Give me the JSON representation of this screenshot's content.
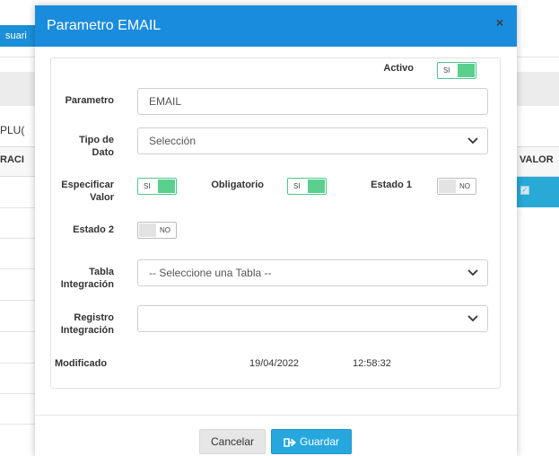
{
  "background": {
    "tab_label": "suari",
    "section_label": "PLU(",
    "table_header_left": "RACI",
    "table_header_right": "VALOR"
  },
  "modal": {
    "title": "Parametro EMAIL",
    "close_icon": "close-icon",
    "activo": {
      "label": "Activo",
      "state": "SI"
    },
    "parametro": {
      "label": "Parametro",
      "value": "EMAIL"
    },
    "tipo_dato": {
      "label": "Tipo de Dato",
      "value": "Selección"
    },
    "especificar_valor": {
      "label": "Especificar Valor",
      "state": "SI"
    },
    "obligatorio": {
      "label": "Obligatorio",
      "state": "SI"
    },
    "estado1": {
      "label": "Estado 1",
      "state": "NO"
    },
    "estado2": {
      "label": "Estado 2",
      "state": "NO"
    },
    "tabla_integracion": {
      "label": "Tabla Integración",
      "value": "-- Seleccione una Tabla --"
    },
    "registro_integracion": {
      "label": "Registro Integración",
      "value": ""
    },
    "modificado": {
      "label": "Modificado",
      "date": "19/04/2022",
      "time": "12:58:32"
    },
    "buttons": {
      "cancel": "Cancelar",
      "save": "Guardar"
    }
  },
  "colors": {
    "header": "#1a8cdd",
    "toggle_on": "#5bcf8e",
    "save_button": "#26a7de"
  }
}
